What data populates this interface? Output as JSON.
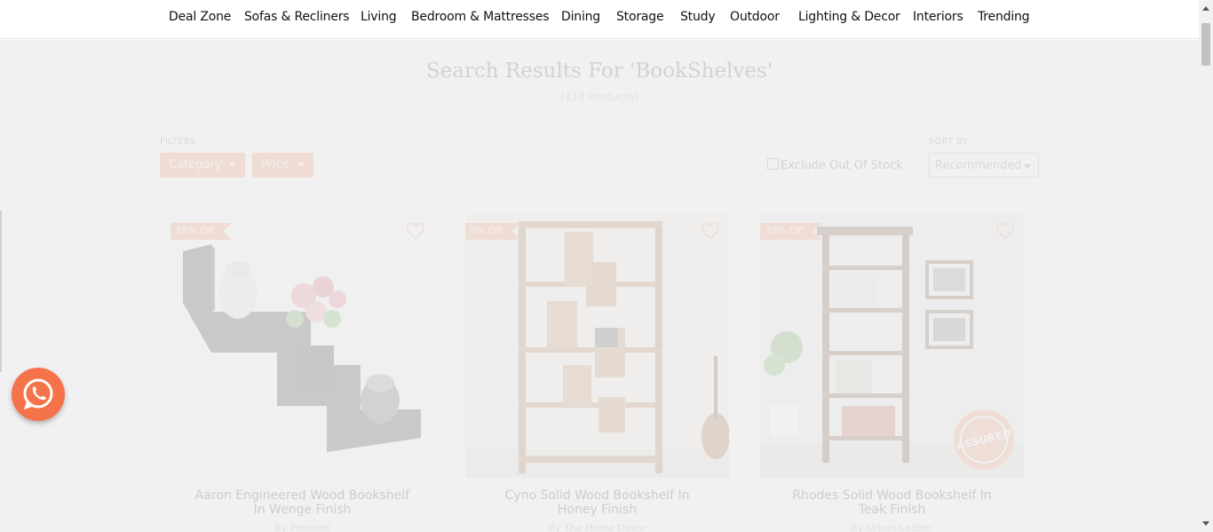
{
  "nav": {
    "items": [
      "Deal Zone",
      "Sofas & Recliners",
      "Living",
      "Bedroom & Mattresses",
      "Dining",
      "Storage",
      "Study",
      "Outdoor",
      "Lighting & Decor",
      "Interiors",
      "Trending"
    ]
  },
  "search": {
    "title": "Search Results For 'BookShelves'",
    "count": "(110 Products)"
  },
  "filters": {
    "label": "FILTERS",
    "category": "Category",
    "price": "Price",
    "exclude_out_of_stock": "Exclude Out Of Stock",
    "exclude_checked": false
  },
  "sort": {
    "label": "SORT BY",
    "selected": "Recommended"
  },
  "products": [
    {
      "badge": "38% Off",
      "name": "Aaron Engineered Wood Bookshelf In Wenge Finish",
      "by": "By Phoenet"
    },
    {
      "badge": "9% Off",
      "name": "Cyno Solid Wood Bookshelf In Honey Finish",
      "by": "By The Home Dekor"
    },
    {
      "badge": "38% Off",
      "name": "Rhodes Solid Wood Bookshelf In Teak Finish",
      "by": "By Urban Ladder"
    }
  ],
  "assured_stamp": "ASSURED",
  "colors": {
    "accent": "#f58a5b",
    "overlay": "#eeeeee",
    "whatsapp": "#f5734a"
  }
}
